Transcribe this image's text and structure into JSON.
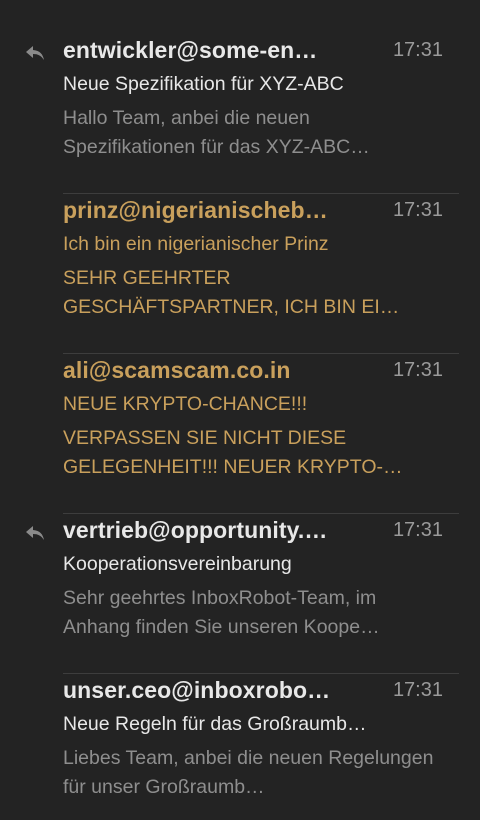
{
  "messages": [
    {
      "sender": "entwickler@some-en…",
      "time": "17:31",
      "subject": "Neue Spezifikation für XYZ-ABC",
      "preview": "Hallo Team, anbei die neuen Spezifikationen für das XYZ-ABC…",
      "replied": true,
      "spam": false
    },
    {
      "sender": "prinz@nigerianischeb…",
      "time": "17:31",
      "subject": "Ich bin ein nigerianischer Prinz",
      "preview": "SEHR GEEHRTER GESCHÄFTSPARTNER, ICH BIN EI…",
      "replied": false,
      "spam": true
    },
    {
      "sender": "ali@scamscam.co.in",
      "time": "17:31",
      "subject": "NEUE KRYPTO-CHANCE!!!",
      "preview": "VERPASSEN SIE NICHT DIESE GELEGENHEIT!!! NEUER KRYPTO-…",
      "replied": false,
      "spam": true
    },
    {
      "sender": "vertrieb@opportunity.…",
      "time": "17:31",
      "subject": "Kooperationsvereinbarung",
      "preview": "Sehr geehrtes InboxRobot-Team, im Anhang finden Sie unseren Koope…",
      "replied": true,
      "spam": false
    },
    {
      "sender": "unser.ceo@inboxrobo…",
      "time": "17:31",
      "subject": "Neue Regeln für das Großraumb…",
      "preview": "Liebes Team, anbei die neuen Regelungen für unser Großraumb…",
      "replied": false,
      "spam": false
    }
  ],
  "colors": {
    "background": "#232323",
    "read_text": "#e8e8e8",
    "preview_text": "#8e8e8e",
    "spam_text": "#c9a05c",
    "time_text": "#9a9a9a",
    "divider": "#3d3d3d",
    "reply_icon": "#8a8a8a"
  },
  "icons": {
    "reply": "reply-arrow-icon"
  }
}
